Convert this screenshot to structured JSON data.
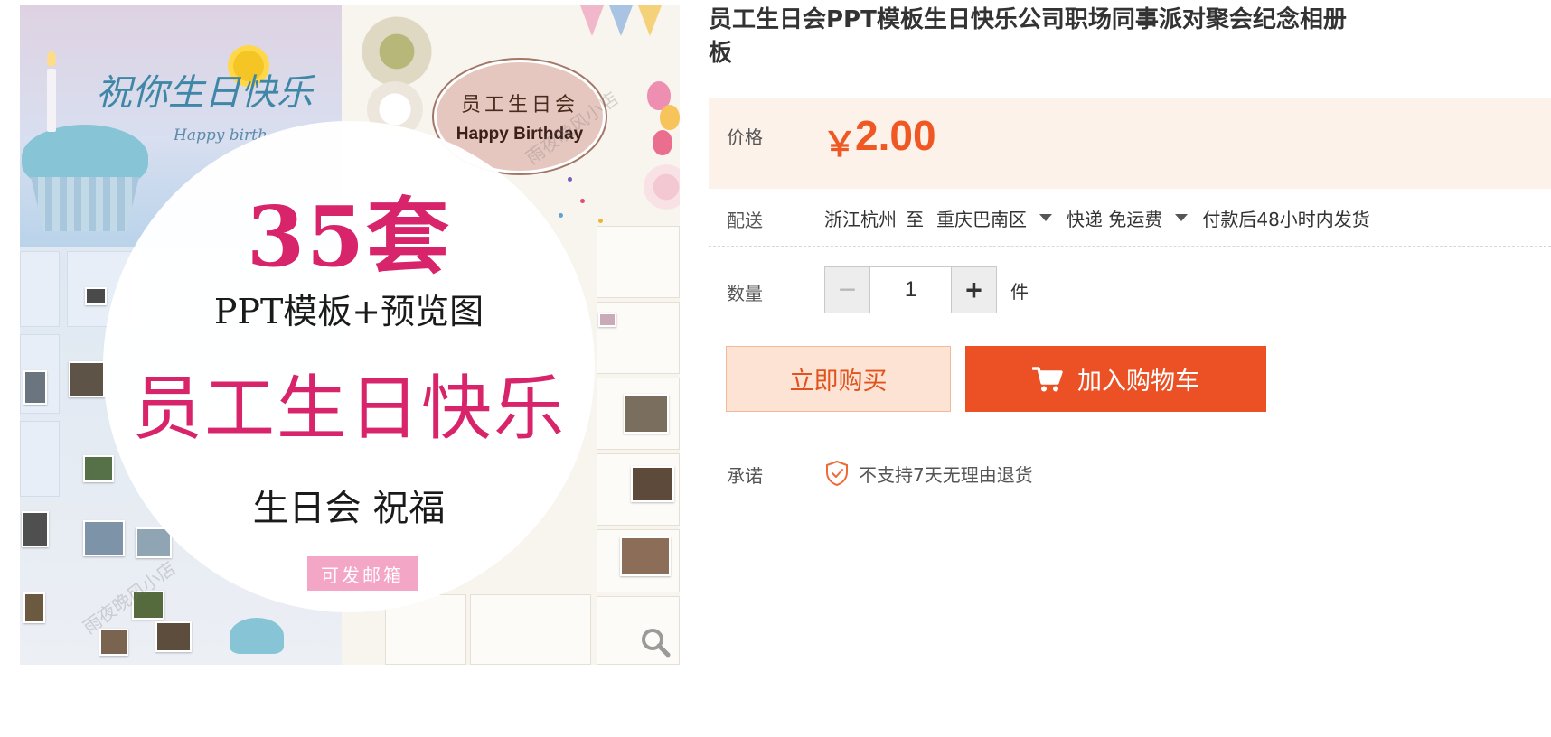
{
  "product": {
    "image": {
      "corner_title": "祝你生日快乐",
      "corner_subtitle": "Happy birth",
      "oval_title": "员工生日会",
      "oval_subtitle": "Happy Birthday",
      "headline_count": "35套",
      "headline_ppt": "PPT模板+预览图",
      "headline_main": "员工生日快乐",
      "headline_sub": "生日会  祝福",
      "mail_badge": "可发邮箱",
      "watermark": "雨夜晚风小店",
      "zoom_icon": "magnifier-icon"
    },
    "title": "员工生日会PPT模板生日快乐公司职场同事派对聚会纪念相册\n板"
  },
  "price": {
    "label": "价格",
    "currency": "￥",
    "value": "2.00",
    "color": "#ef5723"
  },
  "delivery": {
    "label": "配送",
    "from": "浙江杭州",
    "to_word": "至",
    "destination": "重庆巴南区",
    "shipping": "快递 免运费",
    "dispatch_note": "付款后48小时内发货"
  },
  "quantity": {
    "label": "数量",
    "minus": "−",
    "value": "1",
    "plus": "+",
    "unit": "件"
  },
  "actions": {
    "buy_now": "立即购买",
    "add_to_cart": "加入购物车",
    "cart_icon": "shopping-cart-icon",
    "accent": "#ec5126"
  },
  "promise": {
    "label": "承诺",
    "text": "不支持7天无理由退货",
    "icon": "shield-check-icon"
  }
}
